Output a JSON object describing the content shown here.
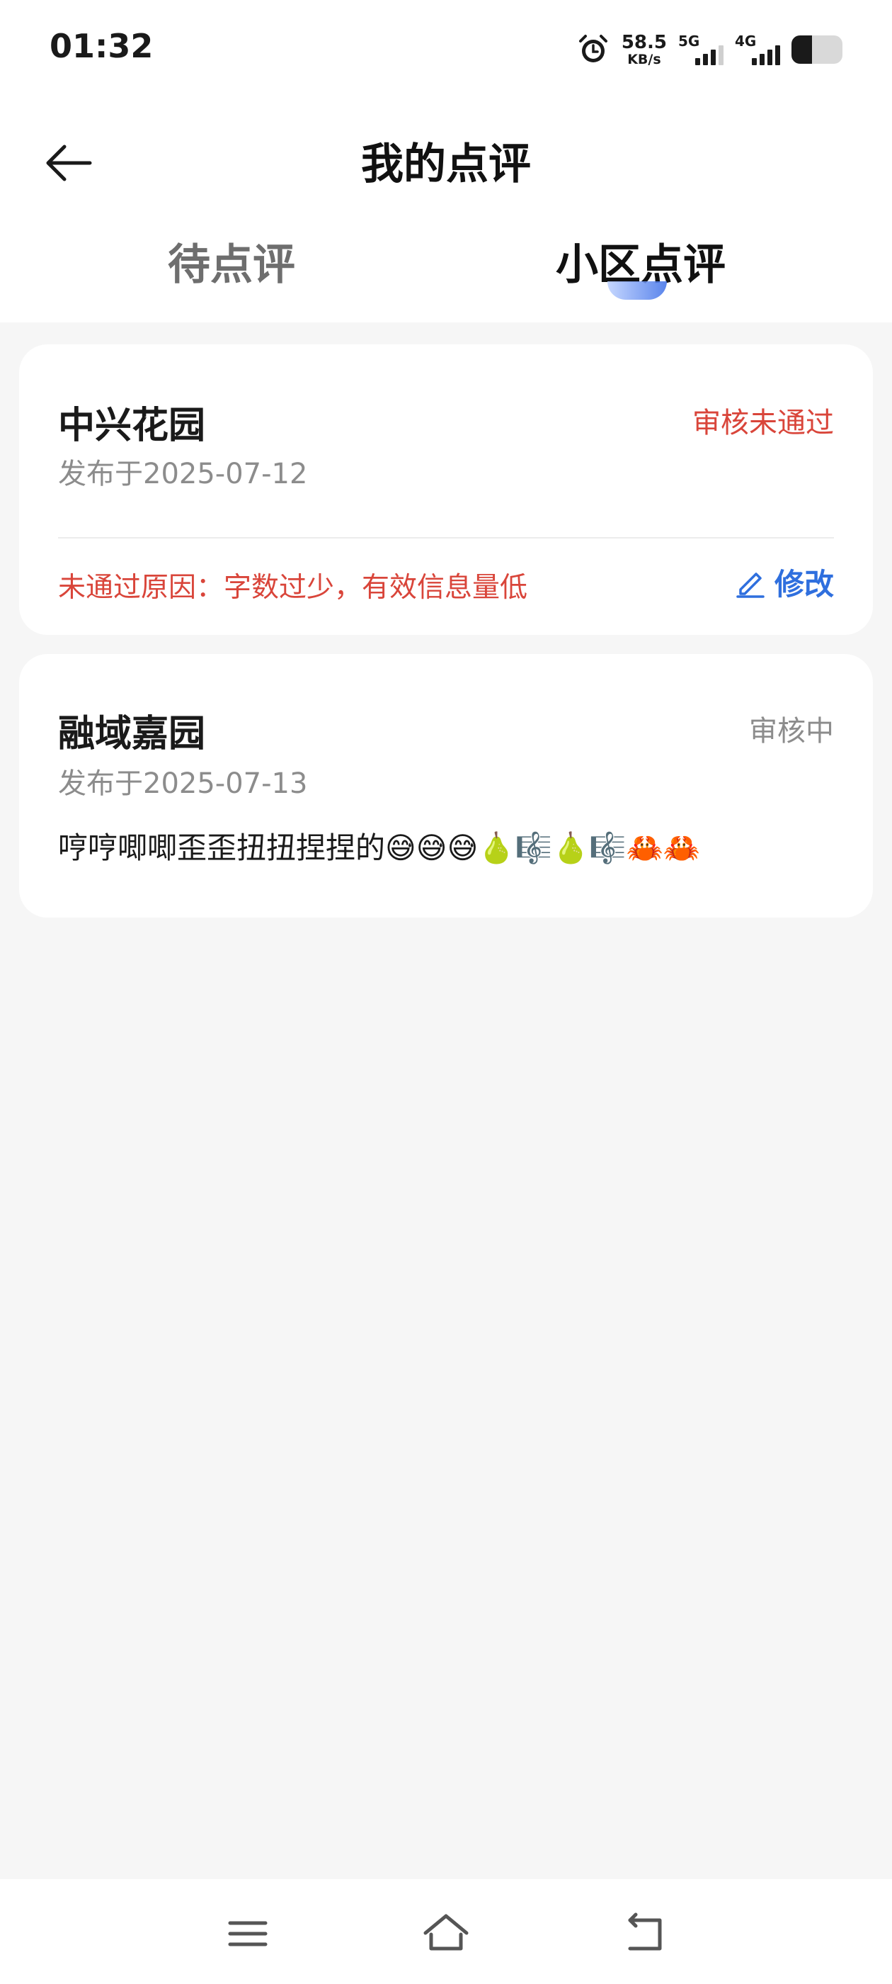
{
  "status_bar": {
    "time": "01:32",
    "net_speed_value": "58.5",
    "net_speed_unit": "KB/s",
    "sim1_label": "5G",
    "sim2_label": "4G",
    "battery_level": 0.4,
    "icons": [
      "alarm-icon",
      "signal-icon",
      "battery-icon"
    ]
  },
  "header": {
    "title": "我的点评",
    "back_icon": "arrow-left-icon"
  },
  "tabs": [
    {
      "label": "待点评",
      "active": false
    },
    {
      "label": "小区点评",
      "active": true
    }
  ],
  "reviews": [
    {
      "community": "中兴花园",
      "date": "发布于2025-07-12",
      "status": "审核未通过",
      "reason": "未通过原因：字数过少，有效信息量低",
      "edit_label": "修改"
    },
    {
      "community": "融域嘉园",
      "date": "发布于2025-07-13",
      "status": "审核中",
      "content": "哼哼唧唧歪歪扭扭捏捏的😅😅😅🍐🎼🍐🎼🦀🦀"
    }
  ],
  "colors": {
    "accent_blue": "#2f6fde",
    "reject_red": "#d9453a",
    "muted_gray": "#8c8c8c",
    "page_bg": "#f6f6f6"
  },
  "nav_icons": [
    "menu-icon",
    "home-icon",
    "back-nav-icon"
  ]
}
